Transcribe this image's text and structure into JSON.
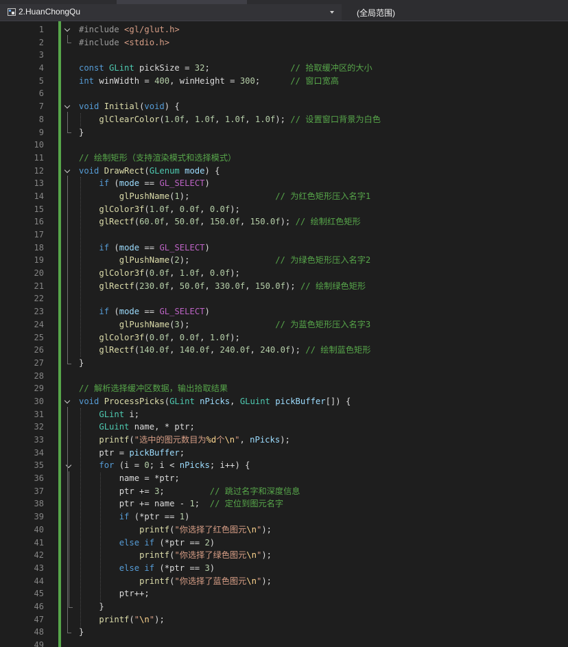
{
  "navbar": {
    "project_name": "2.HuanChongQu",
    "scope": "(全局范围)"
  },
  "editor": {
    "lines": [
      {
        "n": "1",
        "t": [
          [
            "pp",
            "#include "
          ],
          [
            "str",
            "<gl/glut.h>"
          ]
        ]
      },
      {
        "n": "2",
        "t": [
          [
            "pp",
            "#include "
          ],
          [
            "str",
            "<stdio.h>"
          ]
        ]
      },
      {
        "n": "3",
        "t": []
      },
      {
        "n": "4",
        "t": [
          [
            "kw",
            "const "
          ],
          [
            "ty",
            "GLint"
          ],
          [
            "var",
            " pickSize = "
          ],
          [
            "num",
            "32"
          ],
          [
            "var",
            ";                "
          ],
          [
            "cm",
            "// 拾取缓冲区的大小"
          ]
        ]
      },
      {
        "n": "5",
        "t": [
          [
            "kw",
            "int"
          ],
          [
            "var",
            " winWidth = "
          ],
          [
            "num",
            "400"
          ],
          [
            "var",
            ", winHeight = "
          ],
          [
            "num",
            "300"
          ],
          [
            "var",
            ";      "
          ],
          [
            "cm",
            "// 窗口宽高"
          ]
        ]
      },
      {
        "n": "6",
        "t": []
      },
      {
        "n": "7",
        "t": [
          [
            "kw",
            "void "
          ],
          [
            "fn",
            "Initial"
          ],
          [
            "var",
            "("
          ],
          [
            "kw",
            "void"
          ],
          [
            "var",
            ") {"
          ]
        ]
      },
      {
        "n": "8",
        "t": [
          [
            "var",
            "    "
          ],
          [
            "fn",
            "glClearColor"
          ],
          [
            "var",
            "("
          ],
          [
            "num",
            "1.0f"
          ],
          [
            "var",
            ", "
          ],
          [
            "num",
            "1.0f"
          ],
          [
            "var",
            ", "
          ],
          [
            "num",
            "1.0f"
          ],
          [
            "var",
            ", "
          ],
          [
            "num",
            "1.0f"
          ],
          [
            "var",
            "); "
          ],
          [
            "cm",
            "// 设置窗口背景为白色"
          ]
        ]
      },
      {
        "n": "9",
        "t": [
          [
            "var",
            "}"
          ]
        ]
      },
      {
        "n": "10",
        "t": []
      },
      {
        "n": "11",
        "t": [
          [
            "cm",
            "// 绘制矩形（支持渲染模式和选择模式）"
          ]
        ]
      },
      {
        "n": "12",
        "t": [
          [
            "kw",
            "void "
          ],
          [
            "fn",
            "DrawRect"
          ],
          [
            "var",
            "("
          ],
          [
            "ty",
            "GLenum"
          ],
          [
            "par",
            " mode"
          ],
          [
            "var",
            ") {"
          ]
        ]
      },
      {
        "n": "13",
        "t": [
          [
            "var",
            "    "
          ],
          [
            "kw",
            "if"
          ],
          [
            "var",
            " ("
          ],
          [
            "par",
            "mode"
          ],
          [
            "var",
            " == "
          ],
          [
            "mac",
            "GL_SELECT"
          ],
          [
            "var",
            ")"
          ]
        ]
      },
      {
        "n": "14",
        "t": [
          [
            "var",
            "        "
          ],
          [
            "fn",
            "glPushName"
          ],
          [
            "var",
            "("
          ],
          [
            "num",
            "1"
          ],
          [
            "var",
            ");                 "
          ],
          [
            "cm",
            "// 为红色矩形压入名字1"
          ]
        ]
      },
      {
        "n": "15",
        "t": [
          [
            "var",
            "    "
          ],
          [
            "fn",
            "glColor3f"
          ],
          [
            "var",
            "("
          ],
          [
            "num",
            "1.0f"
          ],
          [
            "var",
            ", "
          ],
          [
            "num",
            "0.0f"
          ],
          [
            "var",
            ", "
          ],
          [
            "num",
            "0.0f"
          ],
          [
            "var",
            ");"
          ]
        ]
      },
      {
        "n": "16",
        "t": [
          [
            "var",
            "    "
          ],
          [
            "fn",
            "glRectf"
          ],
          [
            "var",
            "("
          ],
          [
            "num",
            "60.0f"
          ],
          [
            "var",
            ", "
          ],
          [
            "num",
            "50.0f"
          ],
          [
            "var",
            ", "
          ],
          [
            "num",
            "150.0f"
          ],
          [
            "var",
            ", "
          ],
          [
            "num",
            "150.0f"
          ],
          [
            "var",
            "); "
          ],
          [
            "cm",
            "// 绘制红色矩形"
          ]
        ]
      },
      {
        "n": "17",
        "t": []
      },
      {
        "n": "18",
        "t": [
          [
            "var",
            "    "
          ],
          [
            "kw",
            "if"
          ],
          [
            "var",
            " ("
          ],
          [
            "par",
            "mode"
          ],
          [
            "var",
            " == "
          ],
          [
            "mac",
            "GL_SELECT"
          ],
          [
            "var",
            ")"
          ]
        ]
      },
      {
        "n": "19",
        "t": [
          [
            "var",
            "        "
          ],
          [
            "fn",
            "glPushName"
          ],
          [
            "var",
            "("
          ],
          [
            "num",
            "2"
          ],
          [
            "var",
            ");                 "
          ],
          [
            "cm",
            "// 为绿色矩形压入名字2"
          ]
        ]
      },
      {
        "n": "20",
        "t": [
          [
            "var",
            "    "
          ],
          [
            "fn",
            "glColor3f"
          ],
          [
            "var",
            "("
          ],
          [
            "num",
            "0.0f"
          ],
          [
            "var",
            ", "
          ],
          [
            "num",
            "1.0f"
          ],
          [
            "var",
            ", "
          ],
          [
            "num",
            "0.0f"
          ],
          [
            "var",
            ");"
          ]
        ]
      },
      {
        "n": "21",
        "t": [
          [
            "var",
            "    "
          ],
          [
            "fn",
            "glRectf"
          ],
          [
            "var",
            "("
          ],
          [
            "num",
            "230.0f"
          ],
          [
            "var",
            ", "
          ],
          [
            "num",
            "50.0f"
          ],
          [
            "var",
            ", "
          ],
          [
            "num",
            "330.0f"
          ],
          [
            "var",
            ", "
          ],
          [
            "num",
            "150.0f"
          ],
          [
            "var",
            "); "
          ],
          [
            "cm",
            "// 绘制绿色矩形"
          ]
        ]
      },
      {
        "n": "22",
        "t": []
      },
      {
        "n": "23",
        "t": [
          [
            "var",
            "    "
          ],
          [
            "kw",
            "if"
          ],
          [
            "var",
            " ("
          ],
          [
            "par",
            "mode"
          ],
          [
            "var",
            " == "
          ],
          [
            "mac",
            "GL_SELECT"
          ],
          [
            "var",
            ")"
          ]
        ]
      },
      {
        "n": "24",
        "t": [
          [
            "var",
            "        "
          ],
          [
            "fn",
            "glPushName"
          ],
          [
            "var",
            "("
          ],
          [
            "num",
            "3"
          ],
          [
            "var",
            ");                 "
          ],
          [
            "cm",
            "// 为蓝色矩形压入名字3"
          ]
        ]
      },
      {
        "n": "25",
        "t": [
          [
            "var",
            "    "
          ],
          [
            "fn",
            "glColor3f"
          ],
          [
            "var",
            "("
          ],
          [
            "num",
            "0.0f"
          ],
          [
            "var",
            ", "
          ],
          [
            "num",
            "0.0f"
          ],
          [
            "var",
            ", "
          ],
          [
            "num",
            "1.0f"
          ],
          [
            "var",
            ");"
          ]
        ]
      },
      {
        "n": "26",
        "t": [
          [
            "var",
            "    "
          ],
          [
            "fn",
            "glRectf"
          ],
          [
            "var",
            "("
          ],
          [
            "num",
            "140.0f"
          ],
          [
            "var",
            ", "
          ],
          [
            "num",
            "140.0f"
          ],
          [
            "var",
            ", "
          ],
          [
            "num",
            "240.0f"
          ],
          [
            "var",
            ", "
          ],
          [
            "num",
            "240.0f"
          ],
          [
            "var",
            "); "
          ],
          [
            "cm",
            "// 绘制蓝色矩形"
          ]
        ]
      },
      {
        "n": "27",
        "t": [
          [
            "var",
            "}"
          ]
        ]
      },
      {
        "n": "28",
        "t": []
      },
      {
        "n": "29",
        "t": [
          [
            "cm",
            "// 解析选择缓冲区数据，输出拾取结果"
          ]
        ]
      },
      {
        "n": "30",
        "t": [
          [
            "kw",
            "void "
          ],
          [
            "fn",
            "ProcessPicks"
          ],
          [
            "var",
            "("
          ],
          [
            "ty",
            "GLint"
          ],
          [
            "par",
            " nPicks"
          ],
          [
            "var",
            ", "
          ],
          [
            "ty",
            "GLuint"
          ],
          [
            "par",
            " pickBuffer"
          ],
          [
            "var",
            "[]) {"
          ]
        ]
      },
      {
        "n": "31",
        "t": [
          [
            "var",
            "    "
          ],
          [
            "ty",
            "GLint"
          ],
          [
            "var",
            " i;"
          ]
        ]
      },
      {
        "n": "32",
        "t": [
          [
            "var",
            "    "
          ],
          [
            "ty",
            "GLuint"
          ],
          [
            "var",
            " name, * ptr;"
          ]
        ]
      },
      {
        "n": "33",
        "t": [
          [
            "var",
            "    "
          ],
          [
            "fn",
            "printf"
          ],
          [
            "var",
            "("
          ],
          [
            "str",
            "\"选中的图元数目为"
          ],
          [
            "esc",
            "%d"
          ],
          [
            "str",
            "个"
          ],
          [
            "esc",
            "\\n"
          ],
          [
            "str",
            "\""
          ],
          [
            "var",
            ", "
          ],
          [
            "par",
            "nPicks"
          ],
          [
            "var",
            ");"
          ]
        ]
      },
      {
        "n": "34",
        "t": [
          [
            "var",
            "    ptr = "
          ],
          [
            "par",
            "pickBuffer"
          ],
          [
            "var",
            ";"
          ]
        ]
      },
      {
        "n": "35",
        "t": [
          [
            "var",
            "    "
          ],
          [
            "kw",
            "for"
          ],
          [
            "var",
            " (i = "
          ],
          [
            "num",
            "0"
          ],
          [
            "var",
            "; i < "
          ],
          [
            "par",
            "nPicks"
          ],
          [
            "var",
            "; i++) {"
          ]
        ]
      },
      {
        "n": "36",
        "t": [
          [
            "var",
            "        name = *ptr;"
          ]
        ]
      },
      {
        "n": "37",
        "t": [
          [
            "var",
            "        ptr += "
          ],
          [
            "num",
            "3"
          ],
          [
            "var",
            ";         "
          ],
          [
            "cm",
            "// 跳过名字和深度信息"
          ]
        ]
      },
      {
        "n": "38",
        "t": [
          [
            "var",
            "        ptr += name - "
          ],
          [
            "num",
            "1"
          ],
          [
            "var",
            ";  "
          ],
          [
            "cm",
            "// 定位到图元名字"
          ]
        ]
      },
      {
        "n": "39",
        "t": [
          [
            "var",
            "        "
          ],
          [
            "kw",
            "if"
          ],
          [
            "var",
            " (*ptr == "
          ],
          [
            "num",
            "1"
          ],
          [
            "var",
            ")"
          ]
        ]
      },
      {
        "n": "40",
        "t": [
          [
            "var",
            "            "
          ],
          [
            "fn",
            "printf"
          ],
          [
            "var",
            "("
          ],
          [
            "str",
            "\"你选择了红色图元"
          ],
          [
            "esc",
            "\\n"
          ],
          [
            "str",
            "\""
          ],
          [
            "var",
            ");"
          ]
        ]
      },
      {
        "n": "41",
        "t": [
          [
            "var",
            "        "
          ],
          [
            "kw",
            "else if"
          ],
          [
            "var",
            " (*ptr == "
          ],
          [
            "num",
            "2"
          ],
          [
            "var",
            ")"
          ]
        ]
      },
      {
        "n": "42",
        "t": [
          [
            "var",
            "            "
          ],
          [
            "fn",
            "printf"
          ],
          [
            "var",
            "("
          ],
          [
            "str",
            "\"你选择了绿色图元"
          ],
          [
            "esc",
            "\\n"
          ],
          [
            "str",
            "\""
          ],
          [
            "var",
            ");"
          ]
        ]
      },
      {
        "n": "43",
        "t": [
          [
            "var",
            "        "
          ],
          [
            "kw",
            "else if"
          ],
          [
            "var",
            " (*ptr == "
          ],
          [
            "num",
            "3"
          ],
          [
            "var",
            ")"
          ]
        ]
      },
      {
        "n": "44",
        "t": [
          [
            "var",
            "            "
          ],
          [
            "fn",
            "printf"
          ],
          [
            "var",
            "("
          ],
          [
            "str",
            "\"你选择了蓝色图元"
          ],
          [
            "esc",
            "\\n"
          ],
          [
            "str",
            "\""
          ],
          [
            "var",
            ");"
          ]
        ]
      },
      {
        "n": "45",
        "t": [
          [
            "var",
            "        ptr++;"
          ]
        ]
      },
      {
        "n": "46",
        "t": [
          [
            "var",
            "    }"
          ]
        ]
      },
      {
        "n": "47",
        "t": [
          [
            "var",
            "    "
          ],
          [
            "fn",
            "printf"
          ],
          [
            "var",
            "("
          ],
          [
            "str",
            "\""
          ],
          [
            "esc",
            "\\n"
          ],
          [
            "str",
            "\""
          ],
          [
            "var",
            ");"
          ]
        ]
      },
      {
        "n": "48",
        "t": [
          [
            "var",
            "}"
          ]
        ]
      },
      {
        "n": "49",
        "t": []
      }
    ]
  },
  "colors": {
    "background": "#1e1e1e",
    "keyword": "#569cd6",
    "type": "#4ec9b0",
    "function": "#dcdcaa",
    "string": "#d69d85",
    "comment": "#57a64a",
    "macro": "#bd63c5",
    "change_bar": "#57a64a"
  }
}
